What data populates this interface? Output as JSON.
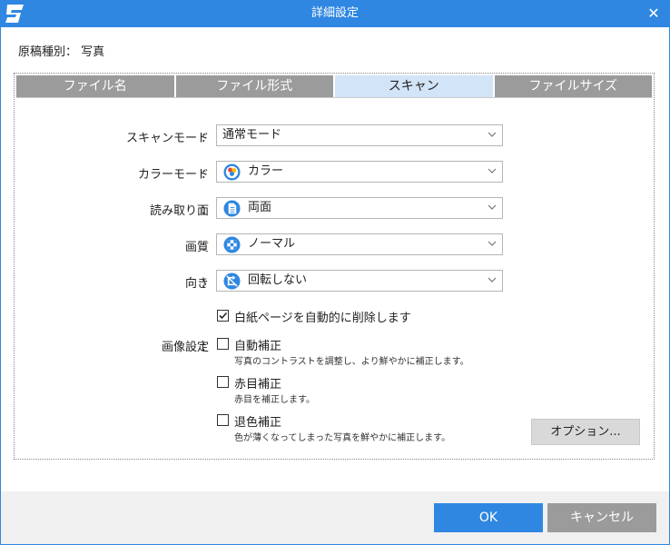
{
  "window": {
    "title": "詳細設定",
    "close_glyph": "✕"
  },
  "doc_type": "原稿種別： 写真",
  "tabs": [
    "ファイル名",
    "ファイル形式",
    "スキャン",
    "ファイルサイズ"
  ],
  "active_tab": "スキャン",
  "fields": {
    "scan_mode": {
      "label": "スキャンモード",
      "value": "通常モード"
    },
    "color_mode": {
      "label": "カラーモード",
      "value": "カラー",
      "icon": "color-palette-icon"
    },
    "scan_side": {
      "label": "読み取り面",
      "value": "両面",
      "icon": "duplex-page-icon"
    },
    "quality": {
      "label": "画質",
      "value": "ノーマル",
      "icon": "quality-grid-icon"
    },
    "orientation": {
      "label": "向き",
      "value": "回転しない",
      "icon": "no-rotate-icon"
    }
  },
  "colon": "：",
  "blank_page": {
    "label": "白紙ページを自動的に削除します",
    "checked": true
  },
  "image_settings": {
    "label": "画像設定",
    "auto": {
      "label": "自動補正",
      "desc": "写真のコントラストを調整し、より鮮やかに補正します。",
      "checked": false
    },
    "redeye": {
      "label": "赤目補正",
      "desc": "赤目を補正します。",
      "checked": false
    },
    "fade": {
      "label": "退色補正",
      "desc": "色が薄くなってしまった写真を鮮やかに補正します。",
      "checked": false
    }
  },
  "buttons": {
    "option": "オプション...",
    "ok": "OK",
    "cancel": "キャンセル"
  },
  "colors": {
    "accent": "#2f87e1",
    "tab_inactive": "#9b9b9b",
    "tab_active": "#d2e4f7"
  }
}
